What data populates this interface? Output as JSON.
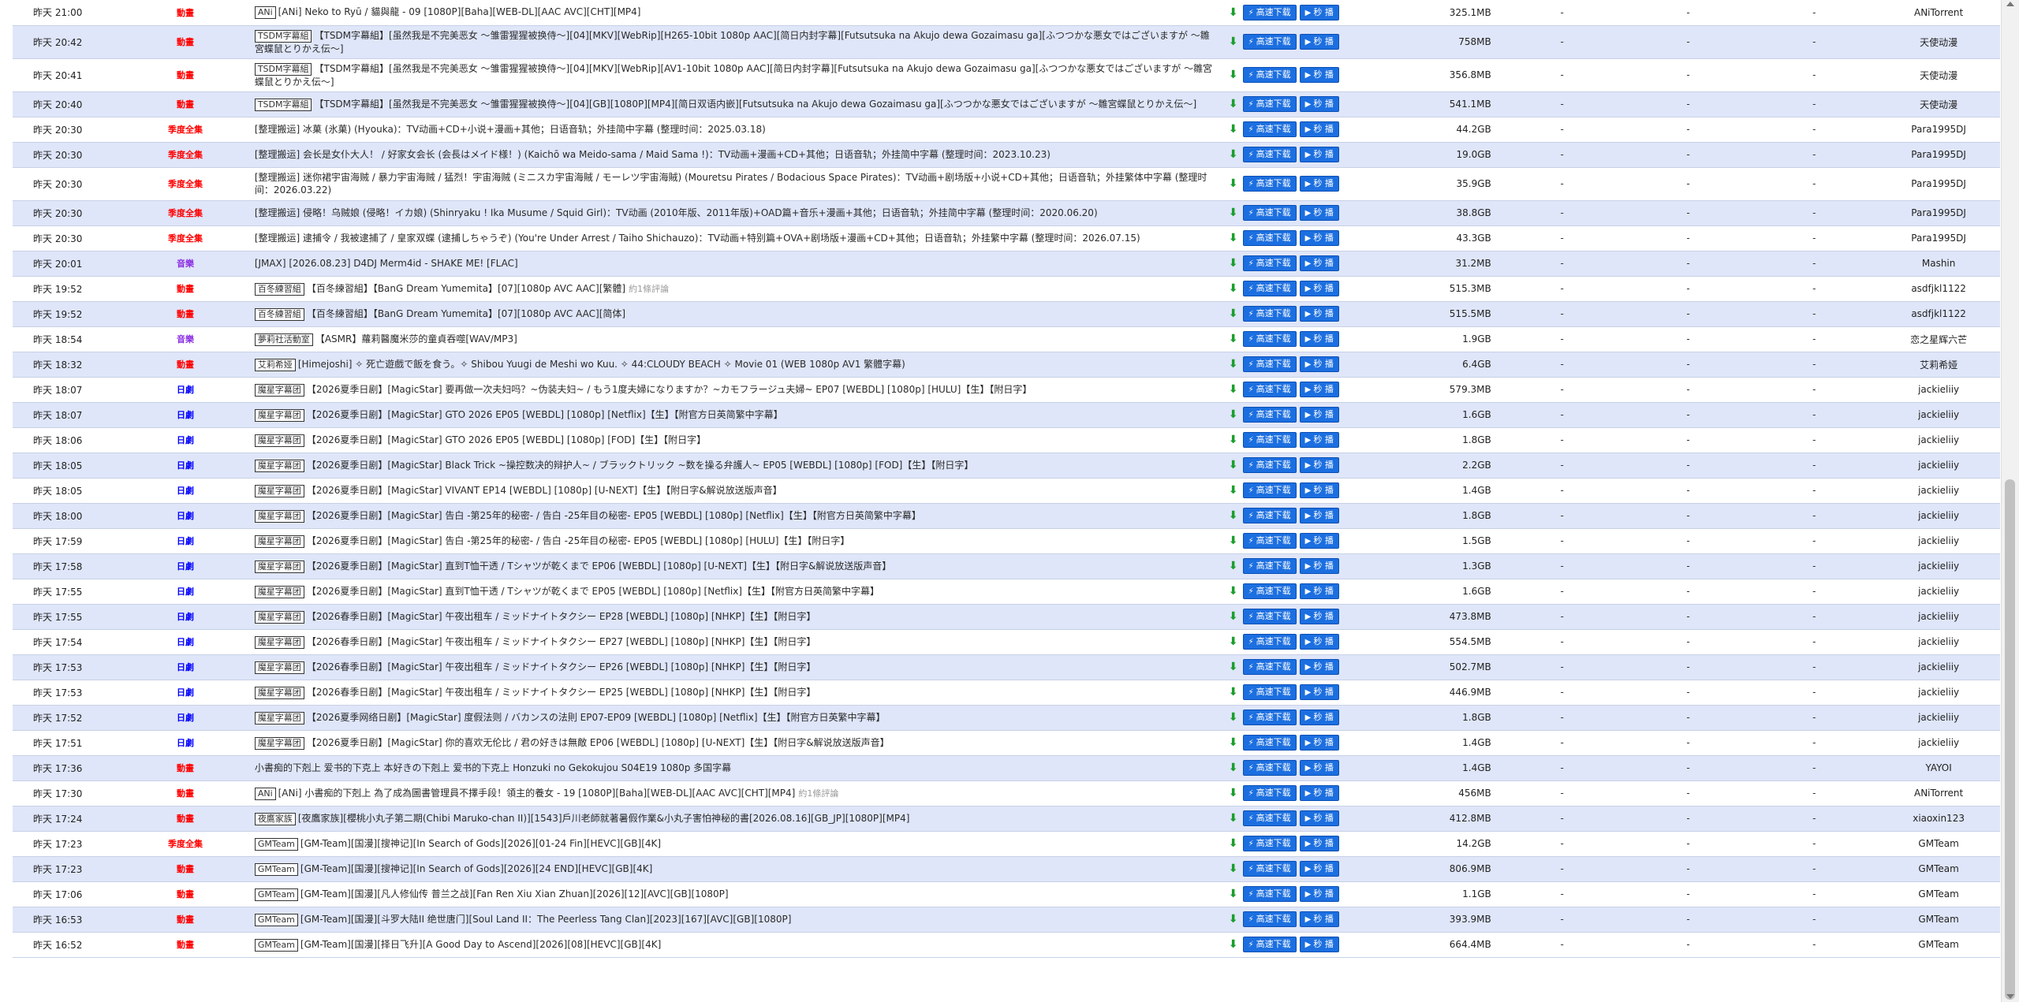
{
  "buttons": {
    "fast_download": "高速下载",
    "instant_play": "秒 播"
  },
  "dash": "-",
  "rows": [
    {
      "time": "昨天 21:00",
      "cat": "動畫",
      "cc": "cat-anime",
      "team": "ANi",
      "title": "[ANi] Neko to Ryū / 貓與龍 - 09 [1080P][Baha][WEB-DL][AAC AVC][CHT][MP4]",
      "comment": "",
      "size": "325.1MB",
      "pub": "ANiTorrent",
      "tall": false
    },
    {
      "time": "昨天 20:42",
      "cat": "動畫",
      "cc": "cat-anime",
      "team": "TSDM字幕組",
      "title": "【TSDM字幕組】[虽然我是不完美恶女 ～雏雷猩猩被换侍～][04][MKV][WebRip][H265-10bit 1080p AAC][简日内封字幕][Futsutsuka na Akujo dewa Gozaimasu ga][ふつつかな悪女ではございますが ～雛宮蝶鼠とりかえ伝～]",
      "comment": "",
      "size": "758MB",
      "pub": "天使动漫",
      "tall": true
    },
    {
      "time": "昨天 20:41",
      "cat": "動畫",
      "cc": "cat-anime",
      "team": "TSDM字幕組",
      "title": "【TSDM字幕組】[虽然我是不完美恶女 ～雏雷猩猩被换侍～][04][MKV][WebRip][AV1-10bit 1080p AAC][简日内封字幕][Futsutsuka na Akujo dewa Gozaimasu ga][ふつつかな悪女ではございますが ～雛宮蝶鼠とりかえ伝～]",
      "comment": "",
      "size": "356.8MB",
      "pub": "天使动漫",
      "tall": true
    },
    {
      "time": "昨天 20:40",
      "cat": "動畫",
      "cc": "cat-anime",
      "team": "TSDM字幕組",
      "title": "【TSDM字幕組】[虽然我是不完美恶女 ～雏雷猩猩被换侍～][04][GB][1080P][MP4][简日双语内嵌][Futsutsuka na Akujo dewa Gozaimasu ga][ふつつかな悪女ではございますが ～雛宮蝶鼠とりかえ伝～]",
      "comment": "",
      "size": "541.1MB",
      "pub": "天使动漫",
      "tall": false
    },
    {
      "time": "昨天 20:30",
      "cat": "季度全集",
      "cc": "cat-season",
      "team": "",
      "title": "[整理搬运] 冰菓 (氷菓) (Hyouka)：TV动画+CD+小说+漫画+其他；日语音轨；外挂简中字幕 (整理时间：2025.03.18)",
      "comment": "",
      "size": "44.2GB",
      "pub": "Para1995DJ",
      "tall": false
    },
    {
      "time": "昨天 20:30",
      "cat": "季度全集",
      "cc": "cat-season",
      "team": "",
      "title": "[整理搬运] 会长是女仆大人！ / 好家女会长 (会長はメイド様！) (Kaichō wa Meido-sama / Maid Sama !)：TV动画+漫画+CD+其他；日语音轨；外挂简中字幕 (整理时间：2023.10.23)",
      "comment": "",
      "size": "19.0GB",
      "pub": "Para1995DJ",
      "tall": false
    },
    {
      "time": "昨天 20:30",
      "cat": "季度全集",
      "cc": "cat-season",
      "team": "",
      "title": "[整理搬运] 迷你裙宇宙海贼 / 暴力宇宙海贼 / 猛烈！宇宙海贼 (ミニスカ宇宙海賊 / モーレツ宇宙海賊) (Mouretsu Pirates / Bodacious Space Pirates)：TV动画+剧场版+小说+CD+其他；日语音轨；外挂繁体中字幕 (整理时间：2026.03.22)",
      "comment": "",
      "size": "35.9GB",
      "pub": "Para1995DJ",
      "tall": true
    },
    {
      "time": "昨天 20:30",
      "cat": "季度全集",
      "cc": "cat-season",
      "team": "",
      "title": "[整理搬运] 侵略！乌贼娘 (侵略！イカ娘) (Shinryaku ! Ika Musume / Squid Girl)：TV动画 (2010年版、2011年版)+OAD篇+音乐+漫画+其他；日语音轨；外挂简中字幕 (整理时间：2020.06.20)",
      "comment": "",
      "size": "38.8GB",
      "pub": "Para1995DJ",
      "tall": false
    },
    {
      "time": "昨天 20:30",
      "cat": "季度全集",
      "cc": "cat-season",
      "team": "",
      "title": "[整理搬运] 逮捕令 / 我被逮捕了 / 皇家双蝶 (逮捕しちゃうぞ) (You're Under Arrest / Taiho Shichauzo)：TV动画+特别篇+OVA+剧场版+漫画+CD+其他；日语音轨；外挂繁中字幕 (整理时间：2026.07.15)",
      "comment": "",
      "size": "43.3GB",
      "pub": "Para1995DJ",
      "tall": false
    },
    {
      "time": "昨天 20:01",
      "cat": "音樂",
      "cc": "cat-music",
      "team": "",
      "title": "[JMAX] [2026.08.23] D4DJ Merm4id - SHAKE ME! [FLAC]",
      "comment": "",
      "size": "31.2MB",
      "pub": "Mashin",
      "tall": false
    },
    {
      "time": "昨天 19:52",
      "cat": "動畫",
      "cc": "cat-anime",
      "team": "百冬練習組",
      "title": "【百冬練習組】【BanG Dream Yumemita】[07][1080p AVC AAC][繁體]",
      "comment": "約1條評論",
      "size": "515.3MB",
      "pub": "asdfjkl1122",
      "tall": false
    },
    {
      "time": "昨天 19:52",
      "cat": "動畫",
      "cc": "cat-anime",
      "team": "百冬練習組",
      "title": "【百冬練習組】【BanG Dream Yumemita】[07][1080p AVC AAC][简体]",
      "comment": "",
      "size": "515.5MB",
      "pub": "asdfjkl1122",
      "tall": false
    },
    {
      "time": "昨天 18:54",
      "cat": "音樂",
      "cc": "cat-music",
      "team": "夢莉社活動室",
      "title": "【ASMR】蘿莉醫魔米莎的童貞吞噬[WAV/MP3]",
      "comment": "",
      "size": "1.9GB",
      "pub": "恋之星辉六芒",
      "tall": false
    },
    {
      "time": "昨天 18:32",
      "cat": "動畫",
      "cc": "cat-anime",
      "team": "艾莉希娅",
      "title": "[Himejoshi] ✧ 死亡遊戲で飯を食う。✧ Shibou Yuugi de Meshi wo Kuu. ✧ 44:CLOUDY BEACH ✧ Movie 01 (WEB 1080p AV1 繁體字幕)",
      "comment": "",
      "size": "6.4GB",
      "pub": "艾莉希娅",
      "tall": false
    },
    {
      "time": "昨天 18:07",
      "cat": "日劇",
      "cc": "cat-drama",
      "team": "魔星字幕团",
      "title": "【2026夏季日剧】[MagicStar] 要再做一次夫妇吗？~伪装夫妇~ / もう1度夫婦になりますか？~カモフラージュ夫婦~ EP07 [WEBDL] [1080p] [HULU]【生】【附日字】",
      "comment": "",
      "size": "579.3MB",
      "pub": "jackieliiy",
      "tall": false
    },
    {
      "time": "昨天 18:07",
      "cat": "日劇",
      "cc": "cat-drama",
      "team": "魔星字幕团",
      "title": "【2026夏季日剧】[MagicStar] GTO 2026 EP05 [WEBDL] [1080p] [Netflix]【生】【附官方日英简繁中字幕】",
      "comment": "",
      "size": "1.6GB",
      "pub": "jackieliiy",
      "tall": false
    },
    {
      "time": "昨天 18:06",
      "cat": "日劇",
      "cc": "cat-drama",
      "team": "魔星字幕团",
      "title": "【2026夏季日剧】[MagicStar] GTO 2026 EP05 [WEBDL] [1080p] [FOD]【生】【附日字】",
      "comment": "",
      "size": "1.8GB",
      "pub": "jackieliiy",
      "tall": false
    },
    {
      "time": "昨天 18:05",
      "cat": "日劇",
      "cc": "cat-drama",
      "team": "魔星字幕团",
      "title": "【2026夏季日剧】[MagicStar] Black Trick ~操控数决的辩护人~ / ブラックトリック ~数を操る弁護人~ EP05 [WEBDL] [1080p] [FOD]【生】【附日字】",
      "comment": "",
      "size": "2.2GB",
      "pub": "jackieliiy",
      "tall": false
    },
    {
      "time": "昨天 18:05",
      "cat": "日劇",
      "cc": "cat-drama",
      "team": "魔星字幕团",
      "title": "【2026夏季日剧】[MagicStar] VIVANT EP14 [WEBDL] [1080p] [U-NEXT]【生】【附日字&解说放送版声音】",
      "comment": "",
      "size": "1.4GB",
      "pub": "jackieliiy",
      "tall": false
    },
    {
      "time": "昨天 18:00",
      "cat": "日劇",
      "cc": "cat-drama",
      "team": "魔星字幕团",
      "title": "【2026夏季日剧】[MagicStar] 告白 -第25年的秘密- / 告白 -25年目の秘密- EP05 [WEBDL] [1080p] [Netflix]【生】【附官方日英简繁中字幕】",
      "comment": "",
      "size": "1.8GB",
      "pub": "jackieliiy",
      "tall": false
    },
    {
      "time": "昨天 17:59",
      "cat": "日劇",
      "cc": "cat-drama",
      "team": "魔星字幕团",
      "title": "【2026夏季日剧】[MagicStar] 告白 -第25年的秘密- / 告白 -25年目の秘密- EP05 [WEBDL] [1080p] [HULU]【生】【附日字】",
      "comment": "",
      "size": "1.5GB",
      "pub": "jackieliiy",
      "tall": false
    },
    {
      "time": "昨天 17:58",
      "cat": "日劇",
      "cc": "cat-drama",
      "team": "魔星字幕团",
      "title": "【2026夏季日剧】[MagicStar] 直到T恤干透 / Tシャツが乾くまで EP06 [WEBDL] [1080p] [U-NEXT]【生】【附日字&解说放送版声音】",
      "comment": "",
      "size": "1.3GB",
      "pub": "jackieliiy",
      "tall": false
    },
    {
      "time": "昨天 17:55",
      "cat": "日劇",
      "cc": "cat-drama",
      "team": "魔星字幕团",
      "title": "【2026夏季日剧】[MagicStar] 直到T恤干透 / Tシャツが乾くまで EP05 [WEBDL] [1080p] [Netflix]【生】【附官方日英简繁中字幕】",
      "comment": "",
      "size": "1.6GB",
      "pub": "jackieliiy",
      "tall": false
    },
    {
      "time": "昨天 17:55",
      "cat": "日劇",
      "cc": "cat-drama",
      "team": "魔星字幕团",
      "title": "【2026春季日剧】[MagicStar] 午夜出租车 / ミッドナイトタクシー EP28 [WEBDL] [1080p] [NHKP]【生】【附日字】",
      "comment": "",
      "size": "473.8MB",
      "pub": "jackieliiy",
      "tall": false
    },
    {
      "time": "昨天 17:54",
      "cat": "日劇",
      "cc": "cat-drama",
      "team": "魔星字幕团",
      "title": "【2026春季日剧】[MagicStar] 午夜出租车 / ミッドナイトタクシー EP27 [WEBDL] [1080p] [NHKP]【生】【附日字】",
      "comment": "",
      "size": "554.5MB",
      "pub": "jackieliiy",
      "tall": false
    },
    {
      "time": "昨天 17:53",
      "cat": "日劇",
      "cc": "cat-drama",
      "team": "魔星字幕团",
      "title": "【2026春季日剧】[MagicStar] 午夜出租车 / ミッドナイトタクシー EP26 [WEBDL] [1080p] [NHKP]【生】【附日字】",
      "comment": "",
      "size": "502.7MB",
      "pub": "jackieliiy",
      "tall": false
    },
    {
      "time": "昨天 17:53",
      "cat": "日劇",
      "cc": "cat-drama",
      "team": "魔星字幕团",
      "title": "【2026春季日剧】[MagicStar] 午夜出租车 / ミッドナイトタクシー EP25 [WEBDL] [1080p] [NHKP]【生】【附日字】",
      "comment": "",
      "size": "446.9MB",
      "pub": "jackieliiy",
      "tall": false
    },
    {
      "time": "昨天 17:52",
      "cat": "日劇",
      "cc": "cat-drama",
      "team": "魔星字幕团",
      "title": "【2026夏季网络日剧】[MagicStar] 度假法则 / バカンスの法則 EP07-EP09 [WEBDL] [1080p] [Netflix]【生】【附官方日英繁中字幕】",
      "comment": "",
      "size": "1.8GB",
      "pub": "jackieliiy",
      "tall": false
    },
    {
      "time": "昨天 17:51",
      "cat": "日劇",
      "cc": "cat-drama",
      "team": "魔星字幕团",
      "title": "【2026夏季日剧】[MagicStar] 你的喜欢无伦比 / 君の好きは無敵 EP06 [WEBDL] [1080p] [U-NEXT]【生】【附日字&解说放送版声音】",
      "comment": "",
      "size": "1.4GB",
      "pub": "jackieliiy",
      "tall": false
    },
    {
      "time": "昨天 17:36",
      "cat": "動畫",
      "cc": "cat-anime",
      "team": "",
      "title": "小書痴的下剋上 爱书的下克上 本好きの下剋上 爱书的下克上 Honzuki no Gekokujou S04E19 1080p 多国字幕",
      "comment": "",
      "size": "1.4GB",
      "pub": "YAYOI",
      "tall": false
    },
    {
      "time": "昨天 17:30",
      "cat": "動畫",
      "cc": "cat-anime",
      "team": "ANi",
      "title": "[ANi] 小書痴的下剋上 為了成為圖書管理員不擇手段！領主的養女 - 19 [1080P][Baha][WEB-DL][AAC AVC][CHT][MP4]",
      "comment": "約1條評論",
      "size": "456MB",
      "pub": "ANiTorrent",
      "tall": false
    },
    {
      "time": "昨天 17:24",
      "cat": "動畫",
      "cc": "cat-anime",
      "team": "夜鷹家族",
      "title": "[夜鷹家族][櫻桃小丸子第二期(Chibi Maruko-chan II)][1543]戶川老師就著暑假作業&小丸子害怕神秘的書[2026.08.16][GB_JP][1080P][MP4]",
      "comment": "",
      "size": "412.8MB",
      "pub": "xiaoxin123",
      "tall": false
    },
    {
      "time": "昨天 17:23",
      "cat": "季度全集",
      "cc": "cat-season",
      "team": "GMTeam",
      "title": "[GM-Team][国漫][搜神记][In Search of Gods][2026][01-24 Fin][HEVC][GB][4K]",
      "comment": "",
      "size": "14.2GB",
      "pub": "GMTeam",
      "tall": false
    },
    {
      "time": "昨天 17:23",
      "cat": "動畫",
      "cc": "cat-anime",
      "team": "GMTeam",
      "title": "[GM-Team][国漫][搜神记][In Search of Gods][2026][24 END][HEVC][GB][4K]",
      "comment": "",
      "size": "806.9MB",
      "pub": "GMTeam",
      "tall": false
    },
    {
      "time": "昨天 17:06",
      "cat": "動畫",
      "cc": "cat-anime",
      "team": "GMTeam",
      "title": "[GM-Team][国漫][凡人修仙传 普兰之战][Fan Ren Xiu Xian Zhuan][2026][12][AVC][GB][1080P]",
      "comment": "",
      "size": "1.1GB",
      "pub": "GMTeam",
      "tall": false
    },
    {
      "time": "昨天 16:53",
      "cat": "動畫",
      "cc": "cat-anime",
      "team": "GMTeam",
      "title": "[GM-Team][国漫][斗罗大陆II 绝世唐门][Soul Land II：The Peerless Tang Clan][2023][167][AVC][GB][1080P]",
      "comment": "",
      "size": "393.9MB",
      "pub": "GMTeam",
      "tall": false
    },
    {
      "time": "昨天 16:52",
      "cat": "動畫",
      "cc": "cat-anime",
      "team": "GMTeam",
      "title": "[GM-Team][国漫][择日飞升][A Good Day to Ascend][2026][08][HEVC][GB][4K]",
      "comment": "",
      "size": "664.4MB",
      "pub": "GMTeam",
      "tall": false
    }
  ]
}
